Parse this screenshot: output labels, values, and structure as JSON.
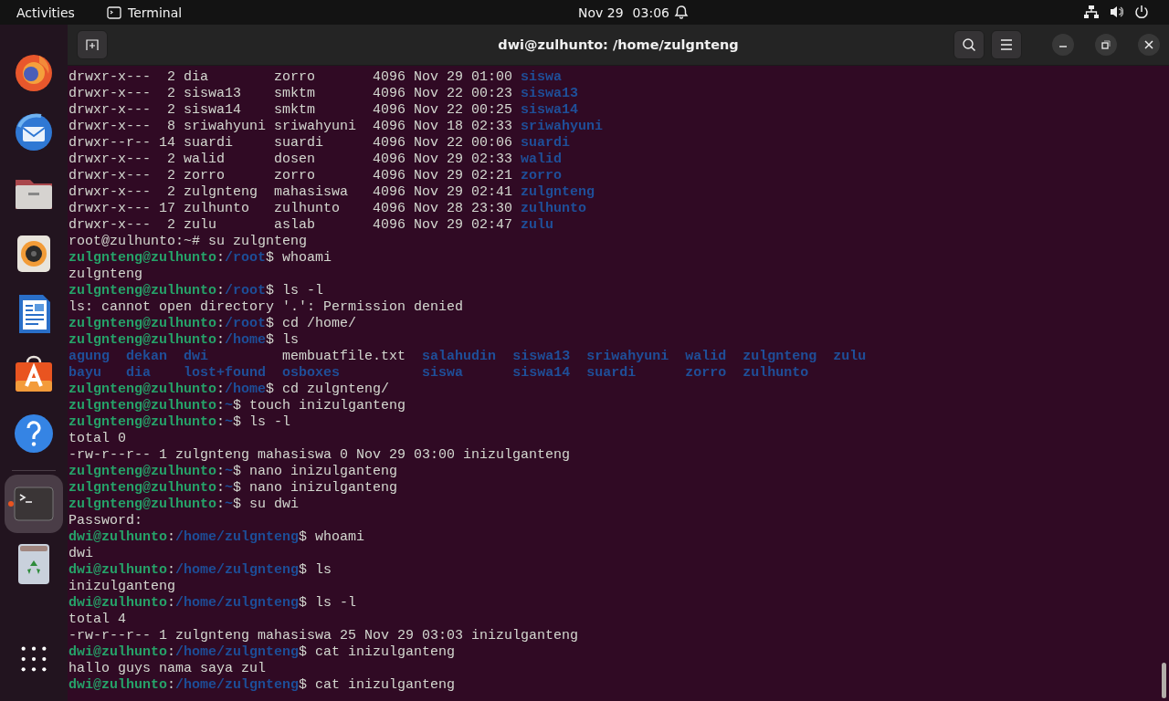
{
  "top_bar": {
    "activities": "Activities",
    "app_name": "Terminal",
    "date": "Nov 29",
    "time": "03:06"
  },
  "dock": {
    "items": [
      {
        "kind": "firefox",
        "active": false
      },
      {
        "kind": "mail",
        "active": false
      },
      {
        "kind": "files",
        "active": false
      },
      {
        "kind": "music",
        "active": false
      },
      {
        "kind": "writer",
        "active": false
      },
      {
        "kind": "store",
        "active": false
      },
      {
        "kind": "help",
        "active": false
      },
      {
        "kind": "terminal",
        "active": true
      },
      {
        "kind": "trash",
        "active": false
      },
      {
        "kind": "apps",
        "active": false
      }
    ]
  },
  "window": {
    "title": "dwi@zulhunto: /home/zulgnteng",
    "lines": [
      {
        "segments": [
          {
            "kind": "plain",
            "text": "drwxr-x---  2 dia        zorro       4096 Nov 29 01:00 "
          },
          {
            "kind": "dir",
            "text": "siswa"
          }
        ]
      },
      {
        "segments": [
          {
            "kind": "plain",
            "text": "drwxr-x---  2 siswa13    smktm       4096 Nov 22 00:23 "
          },
          {
            "kind": "dir",
            "text": "siswa13"
          }
        ]
      },
      {
        "segments": [
          {
            "kind": "plain",
            "text": "drwxr-x---  2 siswa14    smktm       4096 Nov 22 00:25 "
          },
          {
            "kind": "dir",
            "text": "siswa14"
          }
        ]
      },
      {
        "segments": [
          {
            "kind": "plain",
            "text": "drwxr-x---  8 sriwahyuni sriwahyuni  4096 Nov 18 02:33 "
          },
          {
            "kind": "dir",
            "text": "sriwahyuni"
          }
        ]
      },
      {
        "segments": [
          {
            "kind": "plain",
            "text": "drwxr--r-- 14 suardi     suardi      4096 Nov 22 00:06 "
          },
          {
            "kind": "dir",
            "text": "suardi"
          }
        ]
      },
      {
        "segments": [
          {
            "kind": "plain",
            "text": "drwxr-x---  2 walid      dosen       4096 Nov 29 02:33 "
          },
          {
            "kind": "dir",
            "text": "walid"
          }
        ]
      },
      {
        "segments": [
          {
            "kind": "plain",
            "text": "drwxr-x---  2 zorro      zorro       4096 Nov 29 02:21 "
          },
          {
            "kind": "dir",
            "text": "zorro"
          }
        ]
      },
      {
        "segments": [
          {
            "kind": "plain",
            "text": "drwxr-x---  2 zulgnteng  mahasiswa   4096 Nov 29 02:41 "
          },
          {
            "kind": "dir",
            "text": "zulgnteng"
          }
        ]
      },
      {
        "segments": [
          {
            "kind": "plain",
            "text": "drwxr-x--- 17 zulhunto   zulhunto    4096 Nov 28 23:30 "
          },
          {
            "kind": "dir",
            "text": "zulhunto"
          }
        ]
      },
      {
        "segments": [
          {
            "kind": "plain",
            "text": "drwxr-x---  2 zulu       aslab       4096 Nov 29 02:47 "
          },
          {
            "kind": "dir",
            "text": "zulu"
          }
        ]
      },
      {
        "segments": [
          {
            "kind": "plain",
            "text": "root@zulhunto:~# su zulgnteng"
          }
        ]
      },
      {
        "segments": [
          {
            "kind": "user",
            "text": "zulgnteng@zulhunto"
          },
          {
            "kind": "plain",
            "text": ":"
          },
          {
            "kind": "path",
            "text": "/root"
          },
          {
            "kind": "plain",
            "text": "$ whoami"
          }
        ]
      },
      {
        "segments": [
          {
            "kind": "plain",
            "text": "zulgnteng"
          }
        ]
      },
      {
        "segments": [
          {
            "kind": "user",
            "text": "zulgnteng@zulhunto"
          },
          {
            "kind": "plain",
            "text": ":"
          },
          {
            "kind": "path",
            "text": "/root"
          },
          {
            "kind": "plain",
            "text": "$ ls -l"
          }
        ]
      },
      {
        "segments": [
          {
            "kind": "plain",
            "text": "ls: cannot open directory '.': Permission denied"
          }
        ]
      },
      {
        "segments": [
          {
            "kind": "user",
            "text": "zulgnteng@zulhunto"
          },
          {
            "kind": "plain",
            "text": ":"
          },
          {
            "kind": "path",
            "text": "/root"
          },
          {
            "kind": "plain",
            "text": "$ cd /home/"
          }
        ]
      },
      {
        "segments": [
          {
            "kind": "user",
            "text": "zulgnteng@zulhunto"
          },
          {
            "kind": "plain",
            "text": ":"
          },
          {
            "kind": "path",
            "text": "/home"
          },
          {
            "kind": "plain",
            "text": "$ ls"
          }
        ]
      },
      {
        "segments": [
          {
            "kind": "dir",
            "text": "agung  "
          },
          {
            "kind": "dir",
            "text": "dekan  "
          },
          {
            "kind": "dir",
            "text": "dwi         "
          },
          {
            "kind": "plain",
            "text": "membuatfile.txt  "
          },
          {
            "kind": "dir",
            "text": "salahudin  "
          },
          {
            "kind": "dir",
            "text": "siswa13  "
          },
          {
            "kind": "dir",
            "text": "sriwahyuni  "
          },
          {
            "kind": "dir",
            "text": "walid  "
          },
          {
            "kind": "dir",
            "text": "zulgnteng  "
          },
          {
            "kind": "dir",
            "text": "zulu"
          }
        ]
      },
      {
        "segments": [
          {
            "kind": "dir",
            "text": "bayu   "
          },
          {
            "kind": "dir",
            "text": "dia    "
          },
          {
            "kind": "dir",
            "text": "lost+found  "
          },
          {
            "kind": "dir",
            "text": "osboxes          "
          },
          {
            "kind": "dir",
            "text": "siswa      "
          },
          {
            "kind": "dir",
            "text": "siswa14  "
          },
          {
            "kind": "dir",
            "text": "suardi      "
          },
          {
            "kind": "dir",
            "text": "zorro  "
          },
          {
            "kind": "dir",
            "text": "zulhunto"
          }
        ]
      },
      {
        "segments": [
          {
            "kind": "user",
            "text": "zulgnteng@zulhunto"
          },
          {
            "kind": "plain",
            "text": ":"
          },
          {
            "kind": "path",
            "text": "/home"
          },
          {
            "kind": "plain",
            "text": "$ cd zulgnteng/"
          }
        ]
      },
      {
        "segments": [
          {
            "kind": "user",
            "text": "zulgnteng@zulhunto"
          },
          {
            "kind": "plain",
            "text": ":"
          },
          {
            "kind": "path",
            "text": "~"
          },
          {
            "kind": "plain",
            "text": "$ touch inizulganteng"
          }
        ]
      },
      {
        "segments": [
          {
            "kind": "user",
            "text": "zulgnteng@zulhunto"
          },
          {
            "kind": "plain",
            "text": ":"
          },
          {
            "kind": "path",
            "text": "~"
          },
          {
            "kind": "plain",
            "text": "$ ls -l"
          }
        ]
      },
      {
        "segments": [
          {
            "kind": "plain",
            "text": "total 0"
          }
        ]
      },
      {
        "segments": [
          {
            "kind": "plain",
            "text": "-rw-r--r-- 1 zulgnteng mahasiswa 0 Nov 29 03:00 inizulganteng"
          }
        ]
      },
      {
        "segments": [
          {
            "kind": "user",
            "text": "zulgnteng@zulhunto"
          },
          {
            "kind": "plain",
            "text": ":"
          },
          {
            "kind": "path",
            "text": "~"
          },
          {
            "kind": "plain",
            "text": "$ nano inizulganteng"
          }
        ]
      },
      {
        "segments": [
          {
            "kind": "user",
            "text": "zulgnteng@zulhunto"
          },
          {
            "kind": "plain",
            "text": ":"
          },
          {
            "kind": "path",
            "text": "~"
          },
          {
            "kind": "plain",
            "text": "$ nano inizulganteng"
          }
        ]
      },
      {
        "segments": [
          {
            "kind": "user",
            "text": "zulgnteng@zulhunto"
          },
          {
            "kind": "plain",
            "text": ":"
          },
          {
            "kind": "path",
            "text": "~"
          },
          {
            "kind": "plain",
            "text": "$ su dwi"
          }
        ]
      },
      {
        "segments": [
          {
            "kind": "plain",
            "text": "Password:"
          }
        ]
      },
      {
        "segments": [
          {
            "kind": "user",
            "text": "dwi@zulhunto"
          },
          {
            "kind": "plain",
            "text": ":"
          },
          {
            "kind": "path",
            "text": "/home/zulgnteng"
          },
          {
            "kind": "plain",
            "text": "$ whoami"
          }
        ]
      },
      {
        "segments": [
          {
            "kind": "plain",
            "text": "dwi"
          }
        ]
      },
      {
        "segments": [
          {
            "kind": "user",
            "text": "dwi@zulhunto"
          },
          {
            "kind": "plain",
            "text": ":"
          },
          {
            "kind": "path",
            "text": "/home/zulgnteng"
          },
          {
            "kind": "plain",
            "text": "$ ls"
          }
        ]
      },
      {
        "segments": [
          {
            "kind": "plain",
            "text": "inizulganteng"
          }
        ]
      },
      {
        "segments": [
          {
            "kind": "user",
            "text": "dwi@zulhunto"
          },
          {
            "kind": "plain",
            "text": ":"
          },
          {
            "kind": "path",
            "text": "/home/zulgnteng"
          },
          {
            "kind": "plain",
            "text": "$ ls -l"
          }
        ]
      },
      {
        "segments": [
          {
            "kind": "plain",
            "text": "total 4"
          }
        ]
      },
      {
        "segments": [
          {
            "kind": "plain",
            "text": "-rw-r--r-- 1 zulgnteng mahasiswa 25 Nov 29 03:03 inizulganteng"
          }
        ]
      },
      {
        "segments": [
          {
            "kind": "user",
            "text": "dwi@zulhunto"
          },
          {
            "kind": "plain",
            "text": ":"
          },
          {
            "kind": "path",
            "text": "/home/zulgnteng"
          },
          {
            "kind": "plain",
            "text": "$ cat inizulganteng"
          }
        ]
      },
      {
        "segments": [
          {
            "kind": "plain",
            "text": "hallo guys nama saya zul"
          }
        ]
      },
      {
        "segments": [
          {
            "kind": "user",
            "text": "dwi@zulhunto"
          },
          {
            "kind": "plain",
            "text": ":"
          },
          {
            "kind": "path",
            "text": "/home/zulgnteng"
          },
          {
            "kind": "plain",
            "text": "$ cat inizulganteng"
          }
        ]
      }
    ]
  }
}
